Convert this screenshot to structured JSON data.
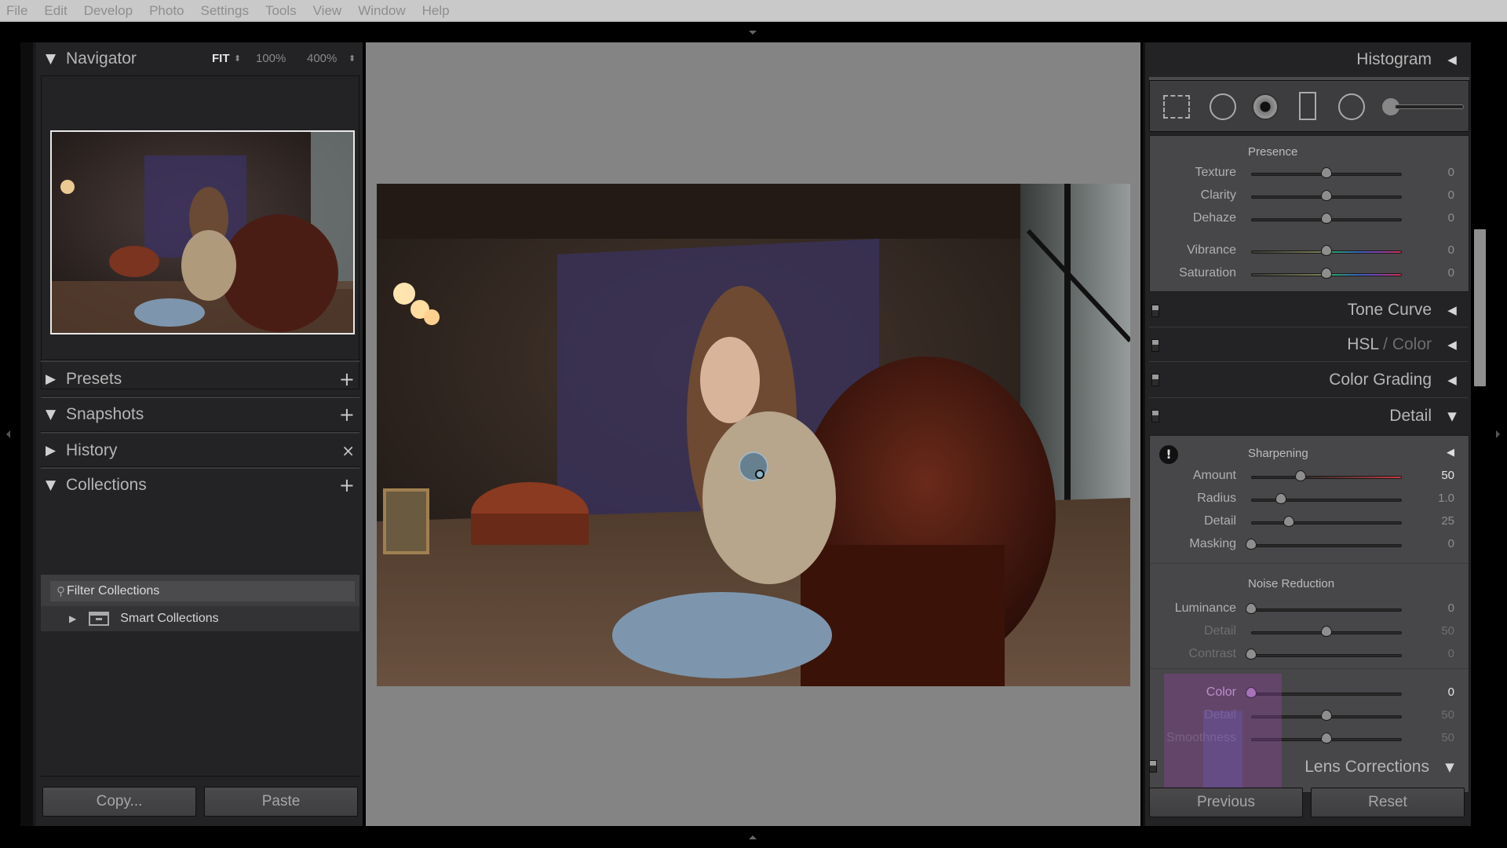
{
  "menu": [
    "File",
    "Edit",
    "Develop",
    "Photo",
    "Settings",
    "Tools",
    "View",
    "Window",
    "Help"
  ],
  "left_panel": {
    "navigator": {
      "title": "Navigator",
      "zoom_options": [
        "FIT",
        "100%",
        "400%"
      ],
      "selected_zoom": "FIT"
    },
    "presets": {
      "title": "Presets",
      "expanded": false,
      "action": "+"
    },
    "snapshots": {
      "title": "Snapshots",
      "expanded": true,
      "action": "+"
    },
    "history": {
      "title": "History",
      "expanded": false,
      "action": "×"
    },
    "collections": {
      "title": "Collections",
      "expanded": true,
      "action": "+",
      "filter_placeholder": "Filter Collections",
      "items": [
        {
          "label": "Smart Collections",
          "expanded": false
        }
      ]
    },
    "buttons": {
      "copy": "Copy...",
      "paste": "Paste"
    }
  },
  "right_panel": {
    "histogram": {
      "title": "Histogram"
    },
    "tools": [
      "crop-overlay",
      "spot-removal",
      "red-eye",
      "graduated-filter",
      "radial-filter",
      "adjustment-brush"
    ],
    "presence": {
      "title": "Presence",
      "sliders": [
        {
          "label": "Texture",
          "value": "0",
          "pos": 0.5
        },
        {
          "label": "Clarity",
          "value": "0",
          "pos": 0.5
        },
        {
          "label": "Dehaze",
          "value": "0",
          "pos": 0.5
        },
        {
          "label": "Vibrance",
          "value": "0",
          "pos": 0.5
        },
        {
          "label": "Saturation",
          "value": "0",
          "pos": 0.5
        }
      ]
    },
    "sections": [
      {
        "title": "Tone Curve",
        "collapsed": true
      },
      {
        "title_primary": "HSL",
        "title_sep": " / ",
        "title_secondary": "Color",
        "collapsed": true
      },
      {
        "title": "Color Grading",
        "collapsed": true
      },
      {
        "title": "Detail",
        "collapsed": false
      }
    ],
    "sharpening": {
      "title": "Sharpening",
      "sliders": [
        {
          "label": "Amount",
          "value": "50",
          "pos": 0.33
        },
        {
          "label": "Radius",
          "value": "1.0",
          "pos": 0.2
        },
        {
          "label": "Detail",
          "value": "25",
          "pos": 0.25
        },
        {
          "label": "Masking",
          "value": "0",
          "pos": 0.0
        }
      ]
    },
    "noise_reduction": {
      "title": "Noise Reduction",
      "sliders": [
        {
          "label": "Luminance",
          "value": "0",
          "pos": 0.0
        },
        {
          "label": "Detail",
          "value": "50",
          "pos": 0.5,
          "dim": true
        },
        {
          "label": "Contrast",
          "value": "0",
          "pos": 0.0,
          "dim": true
        },
        {
          "label": "Color",
          "value": "0",
          "pos": 0.0
        },
        {
          "label": "Detail",
          "value": "50",
          "pos": 0.5,
          "dim": true
        },
        {
          "label": "Smoothness",
          "value": "50",
          "pos": 0.5,
          "dim": true
        }
      ]
    },
    "lens_corrections": {
      "title": "Lens Corrections"
    },
    "buttons": {
      "previous": "Previous",
      "reset": "Reset"
    }
  }
}
